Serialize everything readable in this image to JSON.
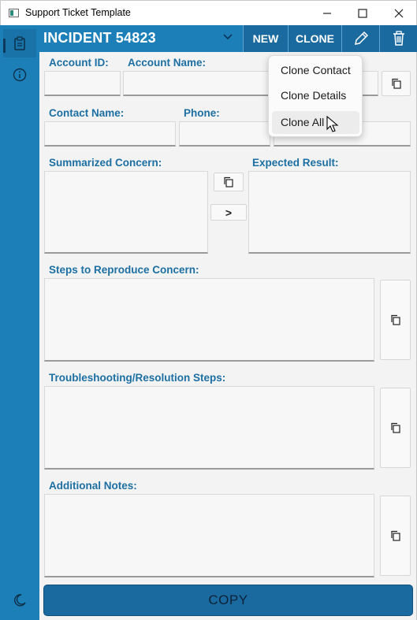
{
  "window": {
    "title": "Support Ticket Template"
  },
  "header": {
    "title": "INCIDENT 54823",
    "new_label": "NEW",
    "clone_label": "CLONE"
  },
  "form": {
    "account_id_label": "Account ID:",
    "account_name_label": "Account Name:",
    "contact_name_label": "Contact Name:",
    "phone_label": "Phone:",
    "summarized_concern_label": "Summarized Concern:",
    "expected_result_label": "Expected Result:",
    "steps_label": "Steps to Reproduce Concern:",
    "troubleshooting_label": "Troubleshooting/Resolution Steps:",
    "notes_label": "Additional Notes:",
    "transfer_label": ">"
  },
  "clone_menu": {
    "items": [
      "Clone Contact",
      "Clone Details",
      "Clone All"
    ],
    "hovered": "Clone All"
  },
  "footer": {
    "copy_label": "COPY"
  },
  "colors": {
    "accent": "#1c7fb8",
    "accent_dark": "#1a6aa0",
    "label": "#1c6fa3"
  },
  "icons": [
    "app-icon",
    "minimize-icon",
    "maximize-icon",
    "close-icon",
    "clipboard-icon",
    "info-icon",
    "moon-icon",
    "chevron-down-icon",
    "pencil-icon",
    "trash-icon",
    "copy-icon",
    "mouse-cursor-icon"
  ]
}
